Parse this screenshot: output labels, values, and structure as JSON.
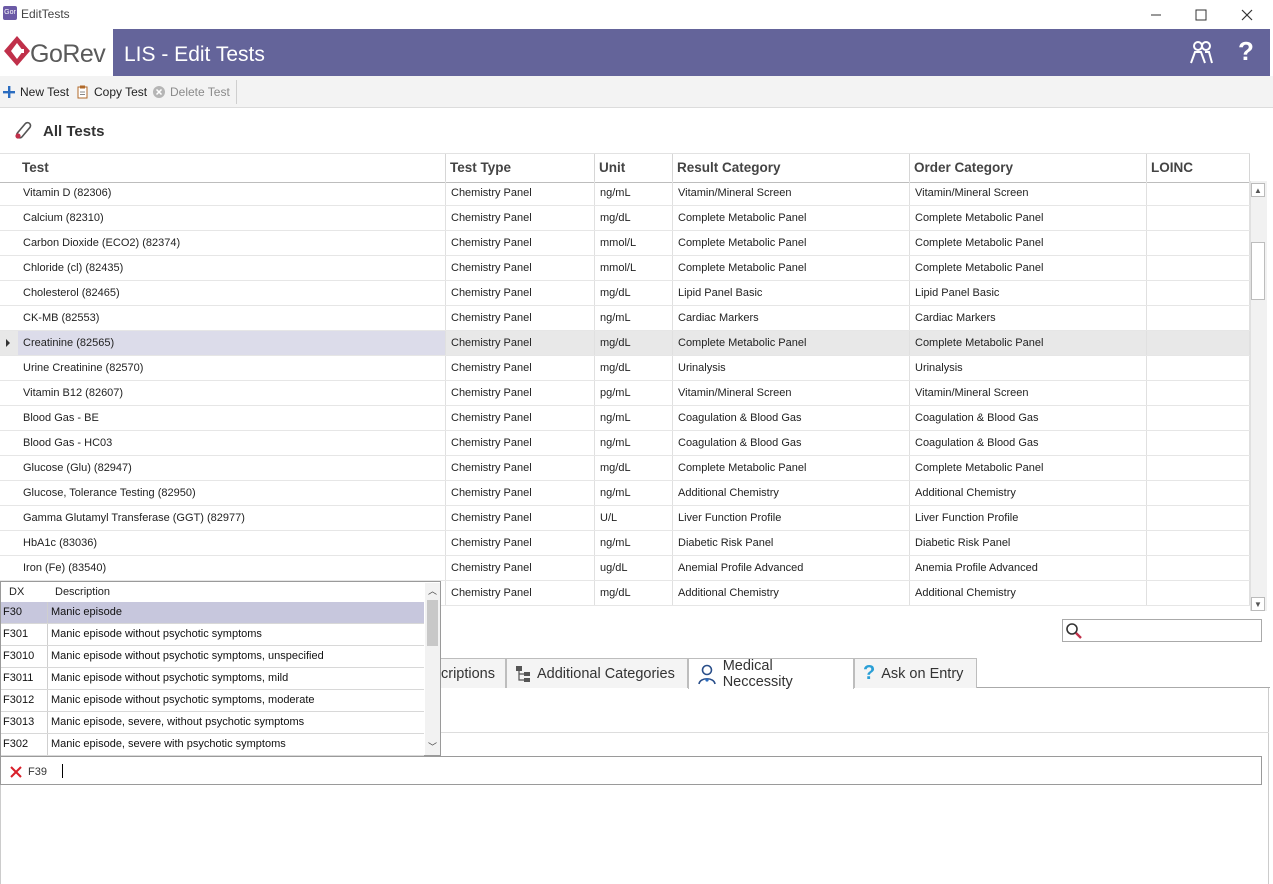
{
  "window": {
    "app_icon_text": "Gor",
    "title": "EditTests"
  },
  "header": {
    "logo_text": "GoRev",
    "title": "LIS - Edit Tests",
    "help_glyph": "?"
  },
  "toolbar": {
    "new_label": "New Test",
    "copy_label": "Copy Test",
    "delete_label": "Delete Test"
  },
  "section": {
    "title": "All Tests"
  },
  "grid": {
    "columns": [
      "Test",
      "Test Type",
      "Unit",
      "Result Category",
      "Order Category",
      "LOINC"
    ],
    "rows": [
      [
        "Vitamin D (82306)",
        "Chemistry Panel",
        "ng/mL",
        "Vitamin/Mineral Screen",
        "Vitamin/Mineral Screen",
        ""
      ],
      [
        "Calcium (82310)",
        "Chemistry Panel",
        "mg/dL",
        "Complete Metabolic Panel",
        "Complete Metabolic Panel",
        ""
      ],
      [
        "Carbon Dioxide (ECO2) (82374)",
        "Chemistry Panel",
        "mmol/L",
        "Complete Metabolic Panel",
        "Complete Metabolic Panel",
        ""
      ],
      [
        "Chloride (cl) (82435)",
        "Chemistry Panel",
        "mmol/L",
        "Complete Metabolic Panel",
        "Complete Metabolic Panel",
        ""
      ],
      [
        "Cholesterol (82465)",
        "Chemistry Panel",
        "mg/dL",
        "Lipid Panel Basic",
        "Lipid Panel Basic",
        ""
      ],
      [
        "CK-MB (82553)",
        "Chemistry Panel",
        "ng/mL",
        "Cardiac Markers",
        "Cardiac Markers",
        ""
      ],
      [
        "Creatinine (82565)",
        "Chemistry Panel",
        "mg/dL",
        "Complete Metabolic Panel",
        "Complete Metabolic Panel",
        ""
      ],
      [
        "Urine Creatinine (82570)",
        "Chemistry Panel",
        "mg/dL",
        "Urinalysis",
        "Urinalysis",
        ""
      ],
      [
        "Vitamin B12 (82607)",
        "Chemistry Panel",
        "pg/mL",
        "Vitamin/Mineral Screen",
        "Vitamin/Mineral Screen",
        ""
      ],
      [
        "Blood Gas - BE",
        "Chemistry Panel",
        "ng/mL",
        "Coagulation & Blood Gas",
        "Coagulation & Blood Gas",
        ""
      ],
      [
        "Blood Gas - HC03",
        "Chemistry Panel",
        "ng/mL",
        "Coagulation & Blood Gas",
        "Coagulation & Blood Gas",
        ""
      ],
      [
        "Glucose (Glu) (82947)",
        "Chemistry Panel",
        "mg/dL",
        "Complete Metabolic Panel",
        "Complete Metabolic Panel",
        ""
      ],
      [
        "Glucose, Tolerance Testing (82950)",
        "Chemistry Panel",
        "ng/mL",
        "Additional Chemistry",
        "Additional Chemistry",
        ""
      ],
      [
        "Gamma Glutamyl Transferase (GGT) (82977)",
        "Chemistry Panel",
        "U/L",
        "Liver Function Profile",
        "Liver Function Profile",
        ""
      ],
      [
        "HbA1c (83036)",
        "Chemistry Panel",
        "ng/mL",
        "Diabetic Risk Panel",
        "Diabetic Risk Panel",
        ""
      ],
      [
        "Iron (Fe) (83540)",
        "Chemistry Panel",
        "ug/dL",
        "Anemial Profile Advanced",
        "Anemia Profile Advanced",
        ""
      ],
      [
        "",
        "Chemistry Panel",
        "mg/dL",
        "Additional Chemistry",
        "Additional Chemistry",
        ""
      ]
    ],
    "selected_row": 6
  },
  "tabs": [
    {
      "label": "criptions",
      "icon": ""
    },
    {
      "label": "Additional Categories",
      "icon": "hierarchy-icon"
    },
    {
      "label": "Medical Neccessity",
      "icon": "doctor-icon",
      "active": true
    },
    {
      "label": "Ask on Entry",
      "icon": "question-icon"
    }
  ],
  "dx_dropdown": {
    "columns": [
      "DX",
      "Description"
    ],
    "rows": [
      {
        "code": "F30",
        "description": "Manic episode",
        "selected": true
      },
      {
        "code": "F301",
        "description": "Manic episode without psychotic symptoms"
      },
      {
        "code": "F3010",
        "description": "Manic episode without psychotic symptoms, unspecified"
      },
      {
        "code": "F3011",
        "description": "Manic episode without psychotic symptoms, mild"
      },
      {
        "code": "F3012",
        "description": "Manic episode without psychotic symptoms, moderate"
      },
      {
        "code": "F3013",
        "description": "Manic episode, severe, without psychotic symptoms"
      },
      {
        "code": "F302",
        "description": "Manic episode, severe with psychotic symptoms"
      }
    ]
  },
  "token_input": {
    "token": "F39"
  },
  "colors": {
    "header_bg": "#64649a",
    "logo_red": "#c0304a",
    "selected_dx": "#c7c7dd",
    "remove_red": "#d9202a"
  }
}
